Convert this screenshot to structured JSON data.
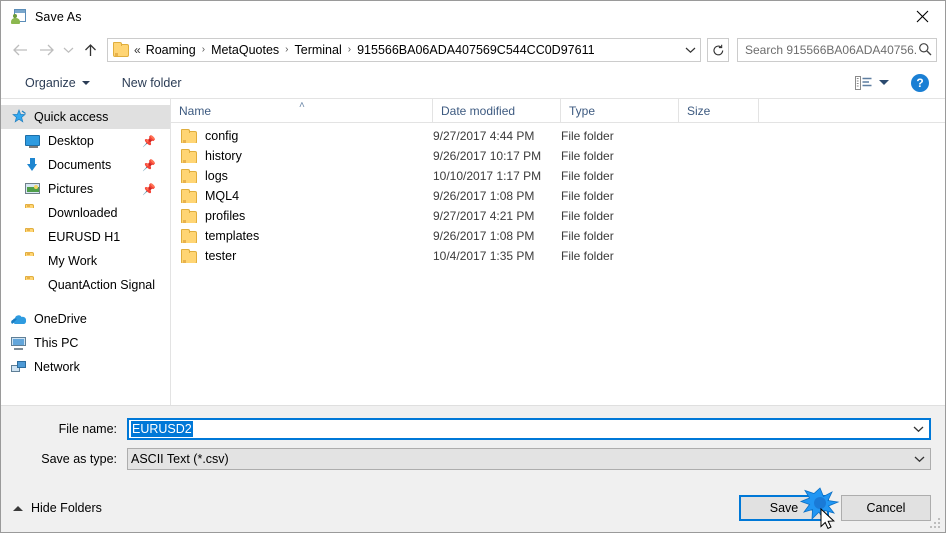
{
  "window": {
    "title": "Save As",
    "icon": "save-as-icon",
    "close_label": "✕"
  },
  "nav": {
    "back_icon": "arrow-left-icon",
    "forward_icon": "arrow-right-icon",
    "recent_icon": "chevron-down-icon",
    "up_icon": "arrow-up-icon",
    "overflow": "«",
    "breadcrumbs": [
      "Roaming",
      "MetaQuotes",
      "Terminal",
      "915566BA06ADA407569C544CC0D97611"
    ],
    "separator": "›",
    "dropdown_icon": "chevron-down-icon",
    "refresh_icon": "refresh-icon"
  },
  "search": {
    "placeholder": "Search 915566BA06ADA40756...",
    "icon": "search-icon"
  },
  "toolbar": {
    "organize_label": "Organize",
    "new_folder_label": "New folder",
    "view_icon": "view-list-icon",
    "view_dropdown_icon": "chevron-down-icon",
    "help_label": "?"
  },
  "sidebar": {
    "items": [
      {
        "label": "Quick access",
        "icon": "star-icon",
        "selected": true,
        "pinned": false,
        "root": true
      },
      {
        "label": "Desktop",
        "icon": "desktop-icon",
        "selected": false,
        "pinned": true,
        "root": false
      },
      {
        "label": "Documents",
        "icon": "documents-icon",
        "selected": false,
        "pinned": true,
        "root": false
      },
      {
        "label": "Pictures",
        "icon": "pictures-icon",
        "selected": false,
        "pinned": true,
        "root": false
      },
      {
        "label": "Downloaded",
        "icon": "folder-icon",
        "selected": false,
        "pinned": false,
        "root": false
      },
      {
        "label": "EURUSD H1",
        "icon": "folder-icon",
        "selected": false,
        "pinned": false,
        "root": false
      },
      {
        "label": "My Work",
        "icon": "folder-icon",
        "selected": false,
        "pinned": false,
        "root": false
      },
      {
        "label": "QuantAction Signal",
        "icon": "folder-icon",
        "selected": false,
        "pinned": false,
        "root": false
      }
    ],
    "roots": [
      {
        "label": "OneDrive",
        "icon": "cloud-icon"
      },
      {
        "label": "This PC",
        "icon": "computer-icon"
      },
      {
        "label": "Network",
        "icon": "network-icon"
      }
    ]
  },
  "filelist": {
    "columns": [
      "Name",
      "Date modified",
      "Type",
      "Size"
    ],
    "sort_indicator": "˄",
    "rows": [
      {
        "name": "config",
        "date": "9/27/2017 4:44 PM",
        "type": "File folder",
        "size": ""
      },
      {
        "name": "history",
        "date": "9/26/2017 10:17 PM",
        "type": "File folder",
        "size": ""
      },
      {
        "name": "logs",
        "date": "10/10/2017 1:17 PM",
        "type": "File folder",
        "size": ""
      },
      {
        "name": "MQL4",
        "date": "9/26/2017 1:08 PM",
        "type": "File folder",
        "size": ""
      },
      {
        "name": "profiles",
        "date": "9/27/2017 4:21 PM",
        "type": "File folder",
        "size": ""
      },
      {
        "name": "templates",
        "date": "9/26/2017 1:08 PM",
        "type": "File folder",
        "size": ""
      },
      {
        "name": "tester",
        "date": "10/4/2017 1:35 PM",
        "type": "File folder",
        "size": ""
      }
    ]
  },
  "form": {
    "filename_label": "File name:",
    "filename_value": "EURUSD2",
    "filetype_label": "Save as type:",
    "filetype_value": "ASCII Text (*.csv)",
    "dropdown_icon": "chevron-down-icon"
  },
  "footer": {
    "hide_folders_label": "Hide Folders",
    "hide_folders_icon": "chevron-up-icon",
    "save_label": "Save",
    "cancel_label": "Cancel",
    "cursor": "arrow-cursor",
    "click_effect": "click-burst"
  },
  "colors": {
    "accent": "#0078d7",
    "folder": "#ffd574",
    "header_text": "#3d5a80",
    "window_bg": "#f0f0f0"
  }
}
